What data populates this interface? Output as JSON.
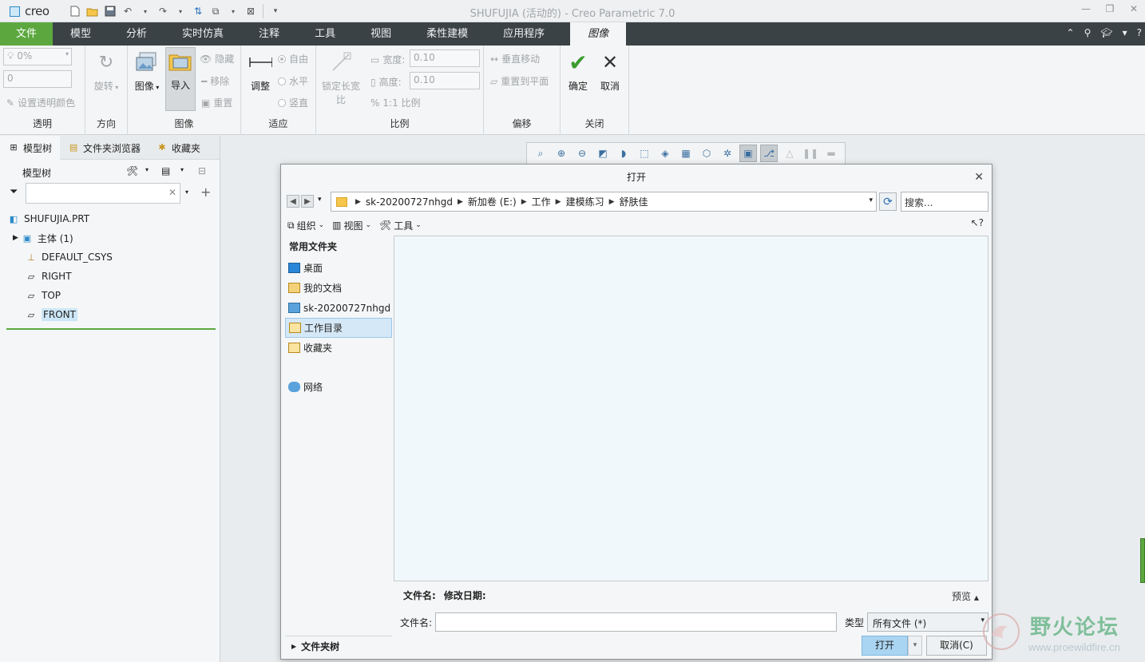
{
  "app": {
    "logo_text": "creo",
    "window_title": "SHUFUJIA (活动的) - Creo Parametric 7.0"
  },
  "tabs": [
    "文件",
    "模型",
    "分析",
    "实时仿真",
    "注释",
    "工具",
    "视图",
    "柔性建模",
    "应用程序",
    "图像"
  ],
  "ribbon": {
    "transparency": {
      "percent": "0%",
      "value": "0",
      "set_color": "设置透明颜色",
      "label": "透明"
    },
    "direction": {
      "rotate": "旋转",
      "label": "方向"
    },
    "image": {
      "image_btn": "图像",
      "import_btn": "导入",
      "hide": "隐藏",
      "remove": "移除",
      "reset": "重置",
      "label": "图像"
    },
    "fit": {
      "adjust": "调整",
      "free": "自由",
      "horizontal": "水平",
      "vertical": "竖直",
      "label": "适应"
    },
    "scale": {
      "lock_ratio_1": "锁定长宽",
      "lock_ratio_2": "比",
      "width_label": "宽度:",
      "width_value": "0.10",
      "height_label": "高度:",
      "height_value": "0.10",
      "ratio": "1:1 比例",
      "label": "比例"
    },
    "offset": {
      "vertical_move": "垂直移动",
      "reset_plane": "重置到平面",
      "label": "偏移"
    },
    "close": {
      "ok": "确定",
      "cancel": "取消",
      "label": "关闭"
    }
  },
  "left_panel": {
    "tabs": [
      "模型树",
      "文件夹浏览器",
      "收藏夹"
    ],
    "tree_title": "模型树",
    "tree": [
      {
        "label": "SHUFUJIA.PRT",
        "icon": "part-icon",
        "indent": 0
      },
      {
        "label": "主体 (1)",
        "icon": "body-icon",
        "indent": 1,
        "expand": true
      },
      {
        "label": "DEFAULT_CSYS",
        "icon": "csys-icon",
        "indent": 1
      },
      {
        "label": "RIGHT",
        "icon": "datum-plane-icon",
        "indent": 1
      },
      {
        "label": "TOP",
        "icon": "datum-plane-icon",
        "indent": 1
      },
      {
        "label": "FRONT",
        "icon": "datum-plane-icon",
        "indent": 1,
        "selected": true
      }
    ]
  },
  "dialog": {
    "title": "打开",
    "breadcrumbs": [
      "sk-20200727nhgd",
      "新加卷 (E:)",
      "工作",
      "建模练习",
      "舒肤佳"
    ],
    "search_placeholder": "搜索...",
    "toolbar": {
      "organize": "组织",
      "views": "视图",
      "tools": "工具"
    },
    "sidebar_heading": "常用文件夹",
    "sidebar_items": [
      "桌面",
      "我的文档",
      "sk-20200727nhgd",
      "工作目录",
      "收藏夹",
      "网络"
    ],
    "folder_tree": "文件夹树",
    "col_filename": "文件名:",
    "col_modified": "修改日期:",
    "preview": "预览",
    "filename_label": "文件名:",
    "filename_value": "",
    "type_label": "类型",
    "type_value": "所有文件 (*)",
    "open_btn": "打开",
    "cancel_btn": "取消(C)"
  },
  "watermark": {
    "text": "野火论坛",
    "url": "www.proewildfire.cn"
  }
}
